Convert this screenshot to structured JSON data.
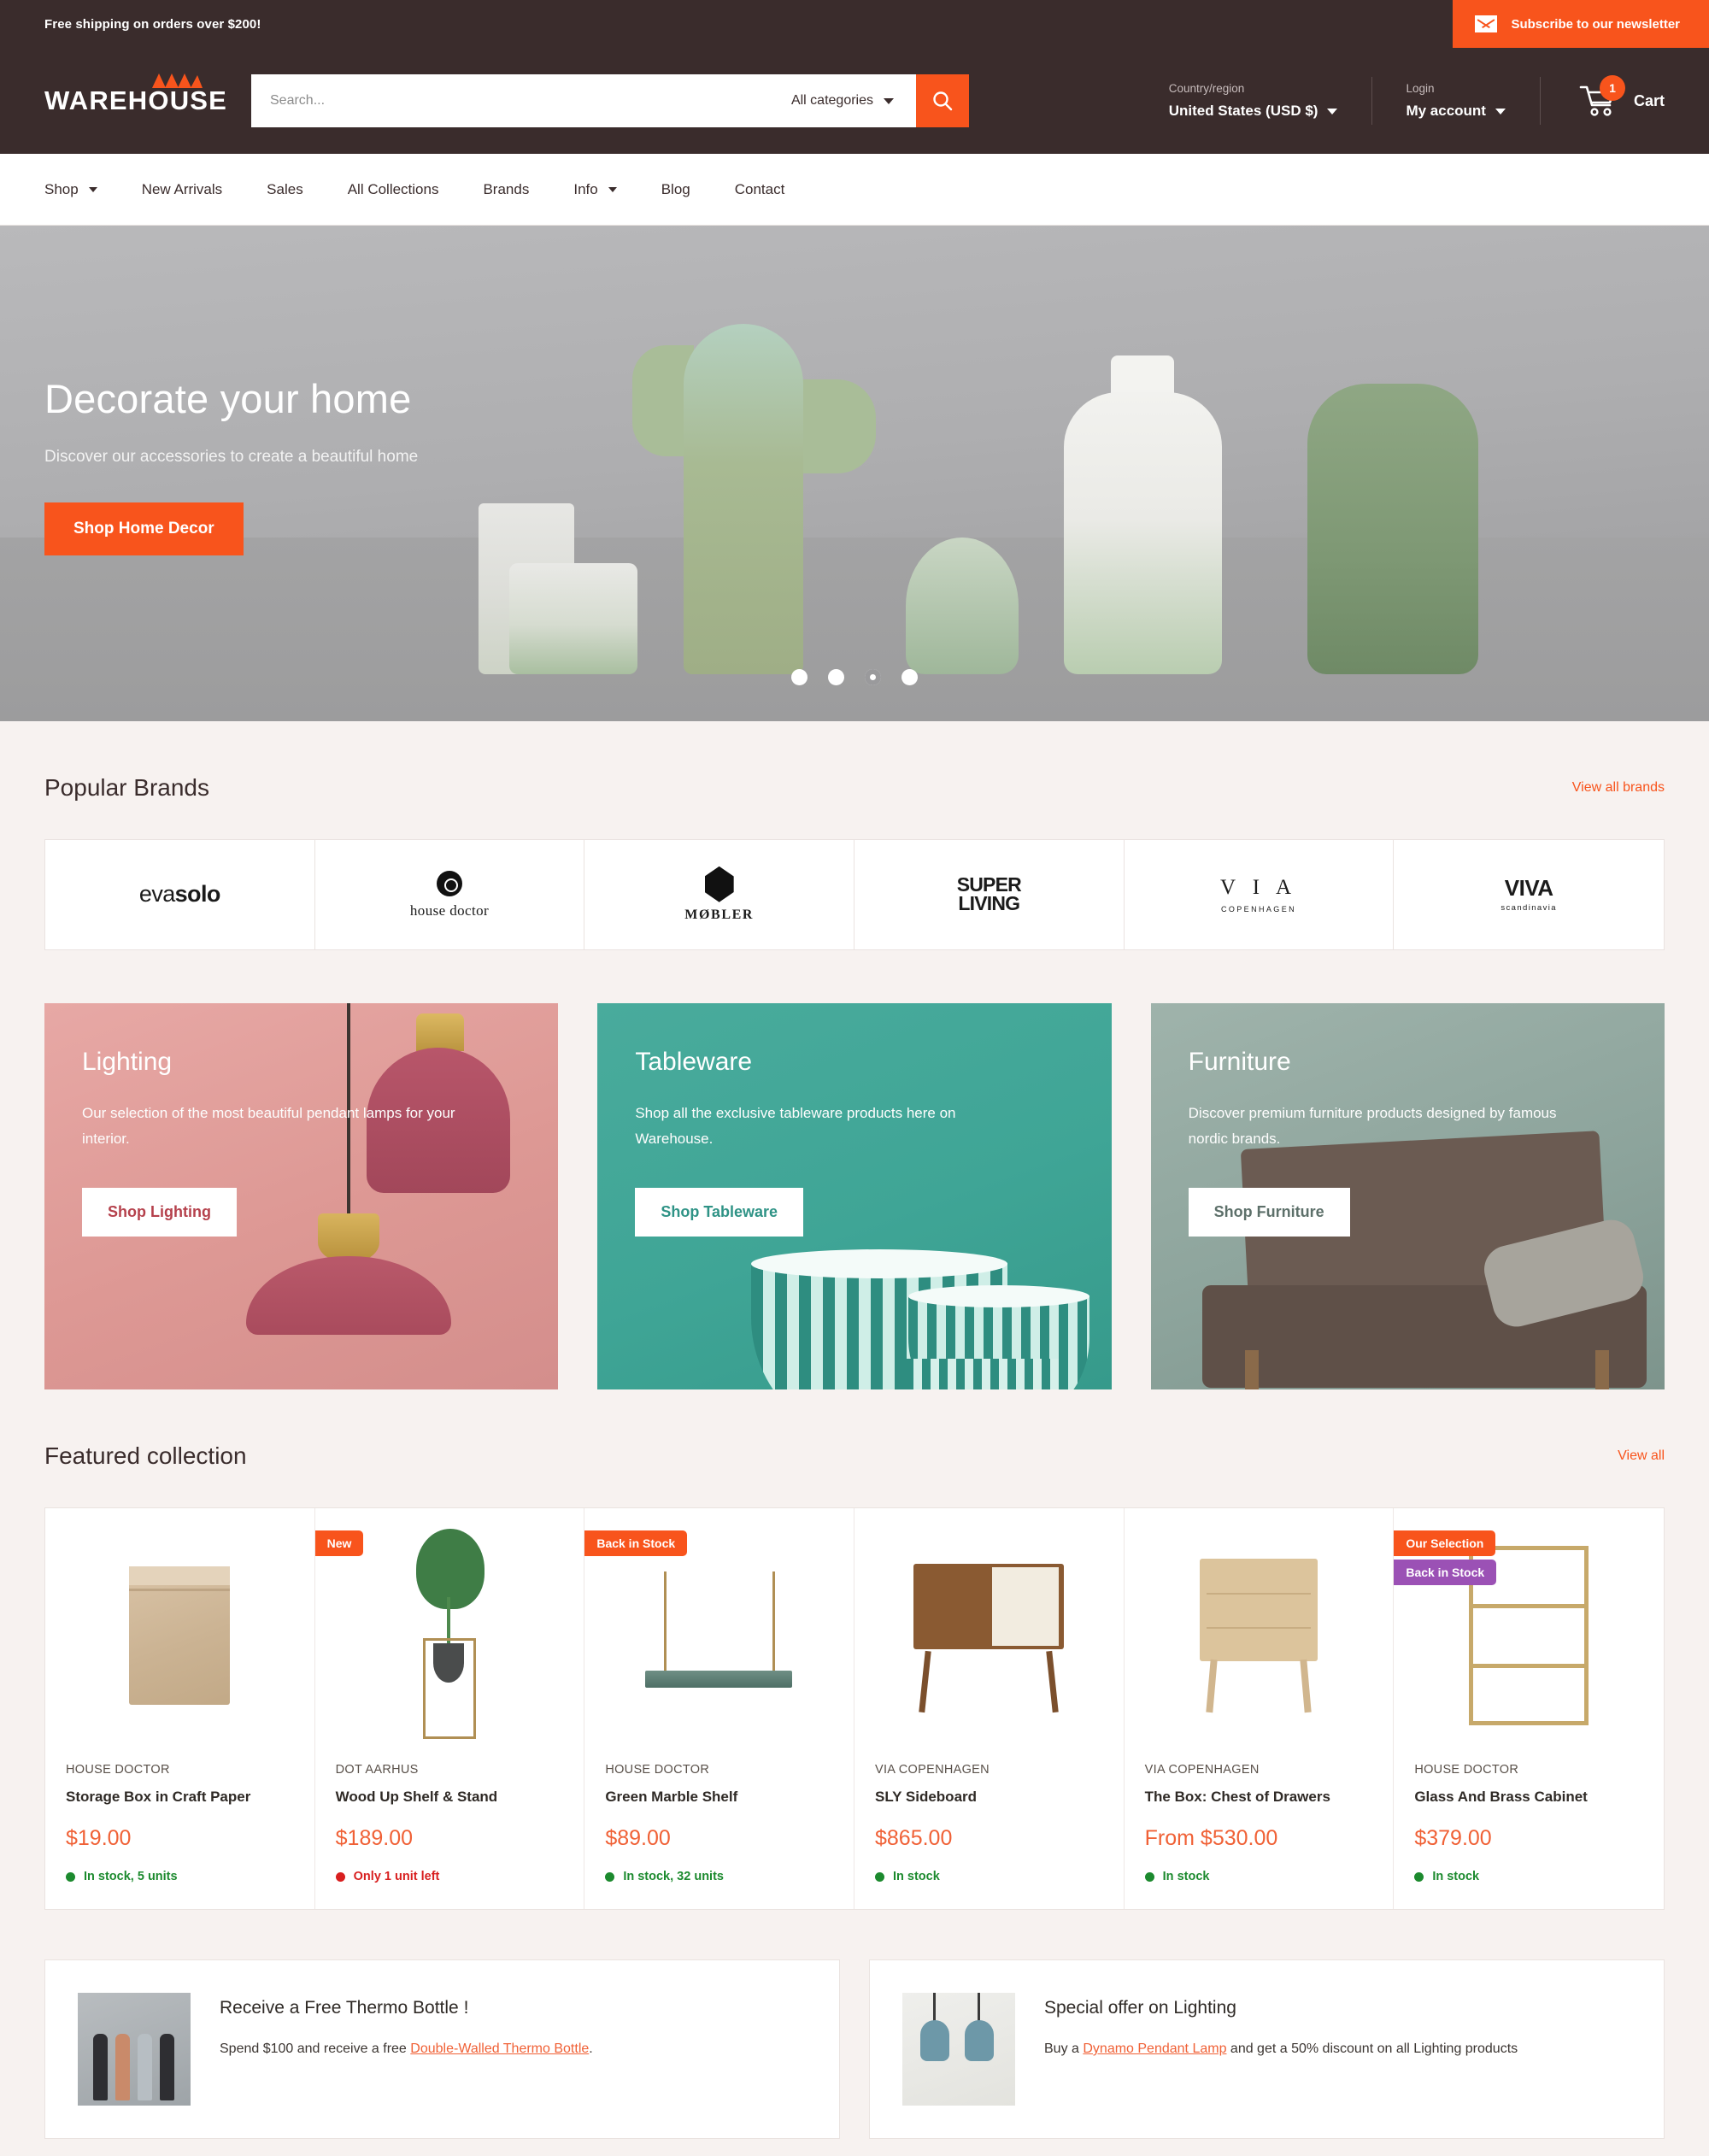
{
  "announcement": {
    "text": "Free shipping on orders over $200!",
    "newsletter_label": "Subscribe to our newsletter",
    "newsletter_icon": "mail-icon"
  },
  "header": {
    "logo": "WAREHOUSE",
    "search": {
      "placeholder": "Search...",
      "value": "",
      "category_label": "All categories",
      "search_icon": "search-icon"
    },
    "country": {
      "label": "Country/region",
      "value": "United States (USD $)"
    },
    "account": {
      "label": "Login",
      "value": "My account"
    },
    "cart": {
      "label": "Cart",
      "count": "1",
      "icon": "cart-icon"
    }
  },
  "nav": {
    "items": [
      {
        "label": "Shop",
        "has_dropdown": true
      },
      {
        "label": "New Arrivals",
        "has_dropdown": false
      },
      {
        "label": "Sales",
        "has_dropdown": false
      },
      {
        "label": "All Collections",
        "has_dropdown": false
      },
      {
        "label": "Brands",
        "has_dropdown": false
      },
      {
        "label": "Info",
        "has_dropdown": true
      },
      {
        "label": "Blog",
        "has_dropdown": false
      },
      {
        "label": "Contact",
        "has_dropdown": false
      }
    ]
  },
  "hero": {
    "title": "Decorate your home",
    "subtitle": "Discover our accessories to create a beautiful home",
    "button": "Shop Home Decor",
    "slides_total": 4,
    "active_slide": 3
  },
  "brands_section": {
    "title": "Popular Brands",
    "link": "View all brands",
    "brands": [
      {
        "name": "eva solo",
        "part1": "eva",
        "part2": "solo"
      },
      {
        "name": "house doctor",
        "text": "house doctor"
      },
      {
        "name": "MØBLER",
        "text": "MØBLER"
      },
      {
        "name": "SUPER LIVING",
        "line1": "SUPER",
        "line2": "LIVING"
      },
      {
        "name": "VIA COPENHAGEN",
        "line1": "V I A",
        "line2": "COPENHAGEN"
      },
      {
        "name": "VIVA scandinavia",
        "line1": "VIVA",
        "line2": "scandinavia"
      }
    ]
  },
  "categories": [
    {
      "title": "Lighting",
      "description": "Our selection of the most beautiful pendant lamps for your interior.",
      "button": "Shop Lighting",
      "accent": "#b5414c"
    },
    {
      "title": "Tableware",
      "description": "Shop all the exclusive tableware products here on Warehouse.",
      "button": "Shop Tableware",
      "accent": "#2f9386"
    },
    {
      "title": "Furniture",
      "description": "Discover premium furniture products designed by famous nordic brands.",
      "button": "Shop Furniture",
      "accent": "#5d706a"
    }
  ],
  "featured": {
    "title": "Featured collection",
    "link": "View all",
    "products": [
      {
        "vendor": "HOUSE DOCTOR",
        "name": "Storage Box in Craft Paper",
        "price": "$19.00",
        "stock": "In stock, 5 units",
        "stock_state": "in",
        "badges": []
      },
      {
        "vendor": "DOT AARHUS",
        "name": "Wood Up Shelf & Stand",
        "price": "$189.00",
        "stock": "Only 1 unit left",
        "stock_state": "low",
        "badges": [
          {
            "label": "New",
            "color": "orange"
          }
        ]
      },
      {
        "vendor": "HOUSE DOCTOR",
        "name": "Green Marble Shelf",
        "price": "$89.00",
        "stock": "In stock, 32 units",
        "stock_state": "in",
        "badges": [
          {
            "label": "Back in Stock",
            "color": "orange"
          }
        ]
      },
      {
        "vendor": "VIA COPENHAGEN",
        "name": "SLY Sideboard",
        "price": "$865.00",
        "stock": "In stock",
        "stock_state": "in",
        "badges": []
      },
      {
        "vendor": "VIA COPENHAGEN",
        "name": "The Box: Chest of Drawers",
        "price": "From $530.00",
        "stock": "In stock",
        "stock_state": "in",
        "badges": []
      },
      {
        "vendor": "HOUSE DOCTOR",
        "name": "Glass And Brass Cabinet",
        "price": "$379.00",
        "stock": "In stock",
        "stock_state": "in",
        "badges": [
          {
            "label": "Our Selection",
            "color": "orange"
          },
          {
            "label": "Back in Stock",
            "color": "purple"
          }
        ]
      }
    ]
  },
  "promos": [
    {
      "title": "Receive a Free Thermo Bottle !",
      "text_before": "Spend $100 and receive a free ",
      "link": "Double-Walled Thermo Bottle",
      "text_after": "."
    },
    {
      "title": "Special offer on Lighting",
      "text_before": "Buy a ",
      "link": "Dynamo Pendant Lamp",
      "text_after": " and get a 50% discount on all Lighting products"
    }
  ],
  "theme": {
    "brand_dark": "#3a2c2c",
    "accent_orange": "#f8541c",
    "price_orange": "#f06136",
    "page_bg": "#f7f2f0",
    "in_stock_green": "#1c8a2e",
    "low_stock_red": "#d81f1f",
    "badge_purple": "#9b51b5"
  }
}
